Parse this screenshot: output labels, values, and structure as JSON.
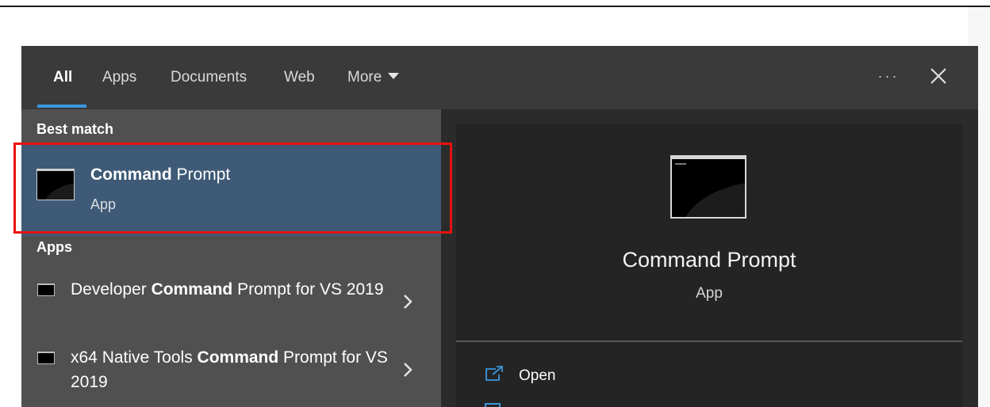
{
  "tabs": [
    {
      "label": "All"
    },
    {
      "label": "Apps"
    },
    {
      "label": "Documents"
    },
    {
      "label": "Web"
    },
    {
      "label": "More"
    }
  ],
  "toolbar": {
    "more_options": "···"
  },
  "best_match": {
    "heading": "Best match",
    "title_bold": "Command",
    "title_rest": " Prompt",
    "subtitle": "App"
  },
  "apps_section": {
    "heading": "Apps",
    "items": [
      {
        "pre": "Developer ",
        "bold": "Command",
        "post": " Prompt for VS 2019"
      },
      {
        "pre": "x64 Native Tools ",
        "bold": "Command",
        "post": " Prompt for VS 2019"
      }
    ]
  },
  "preview": {
    "title": "Command Prompt",
    "subtitle": "App",
    "actions": [
      {
        "label": "Open"
      }
    ]
  },
  "colors": {
    "accent": "#3a96dd",
    "selection": "#3e5a77",
    "highlight_border": "#e81010"
  }
}
